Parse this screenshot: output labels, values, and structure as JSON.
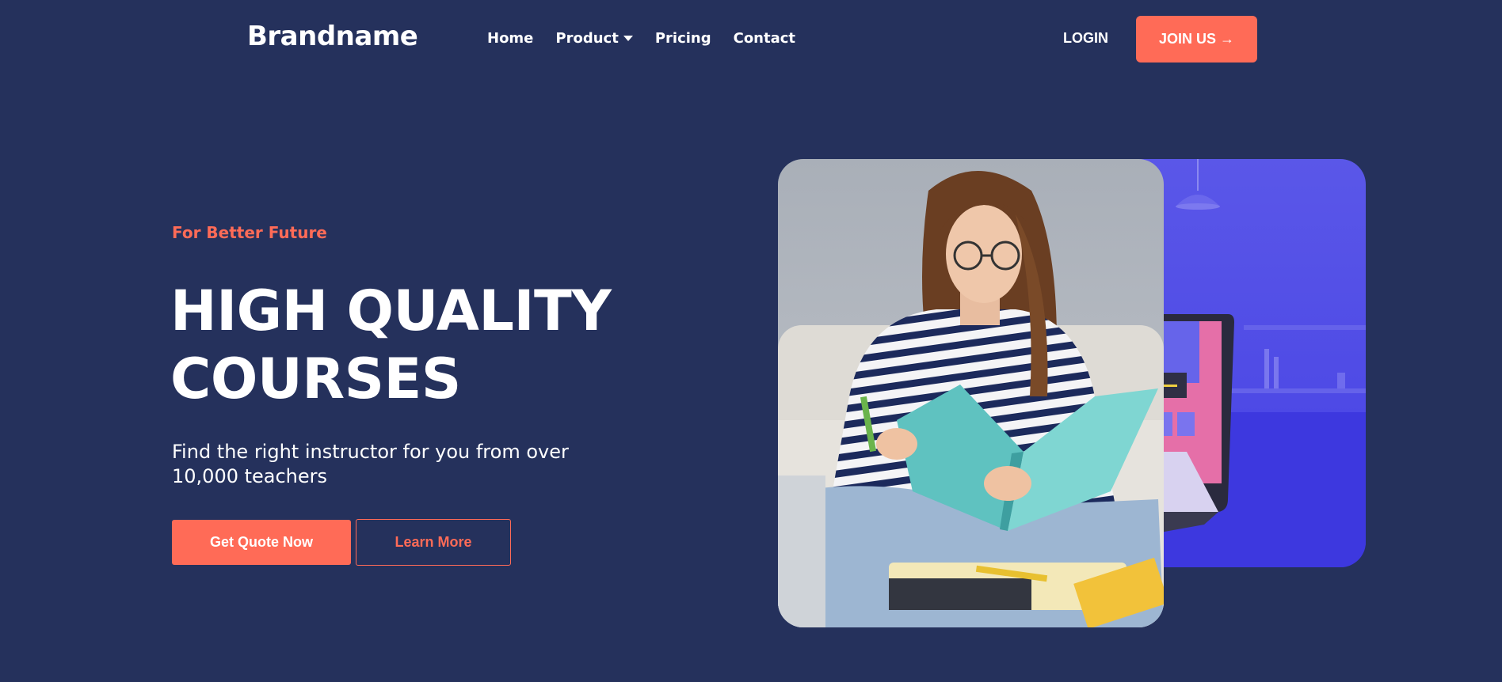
{
  "header": {
    "brand": "Brandname",
    "nav": [
      {
        "label": "Home"
      },
      {
        "label": "Product"
      },
      {
        "label": "Pricing"
      },
      {
        "label": "Contact"
      }
    ],
    "login_label": "LOGIN",
    "join_label": "JOIN US →"
  },
  "hero": {
    "eyebrow": "For Better Future",
    "headline_line1": "HIGH QUALITY",
    "headline_line2": "COURSES",
    "subtext": "Find the right instructor for you from over 10,000 teachers",
    "primary_cta": "Get Quote Now",
    "secondary_cta": "Learn More"
  },
  "colors": {
    "background": "#25315c",
    "accent": "#ff6b57",
    "text": "#ffffff",
    "illustration_blue": "#4b46e6"
  }
}
